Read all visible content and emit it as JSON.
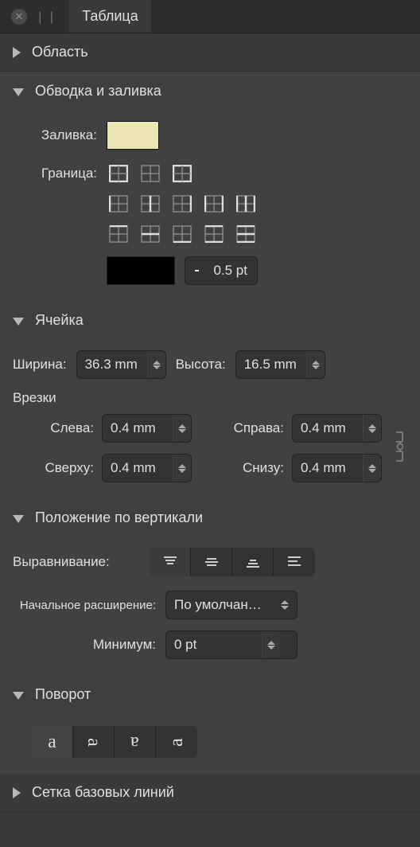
{
  "tab": {
    "title": "Таблица"
  },
  "sections": {
    "region": {
      "title": "Область"
    },
    "stroke_fill": {
      "title": "Обводка и заливка",
      "fill_label": "Заливка:",
      "border_label": "Граница:",
      "fill_color": "#ece6b4",
      "stroke_color": "#000000",
      "stroke_width": "0.5 pt"
    },
    "cell": {
      "title": "Ячейка",
      "width_label": "Ширина:",
      "width_value": "36.3 mm",
      "height_label": "Высота:",
      "height_value": "16.5 mm",
      "insets_label": "Врезки",
      "left_label": "Слева:",
      "left_value": "0.4 mm",
      "right_label": "Справа:",
      "right_value": "0.4 mm",
      "top_label": "Сверху:",
      "top_value": "0.4 mm",
      "bottom_label": "Снизу:",
      "bottom_value": "0.4 mm"
    },
    "valign": {
      "title": "Положение по вертикали",
      "align_label": "Выравнивание:",
      "ext_label": "Начальное расширение:",
      "ext_value": "По умолчан…",
      "min_label": "Минимум:",
      "min_value": "0 pt"
    },
    "rotate": {
      "title": "Поворот",
      "glyph": "a"
    },
    "baseline": {
      "title": "Сетка базовых линий"
    }
  }
}
